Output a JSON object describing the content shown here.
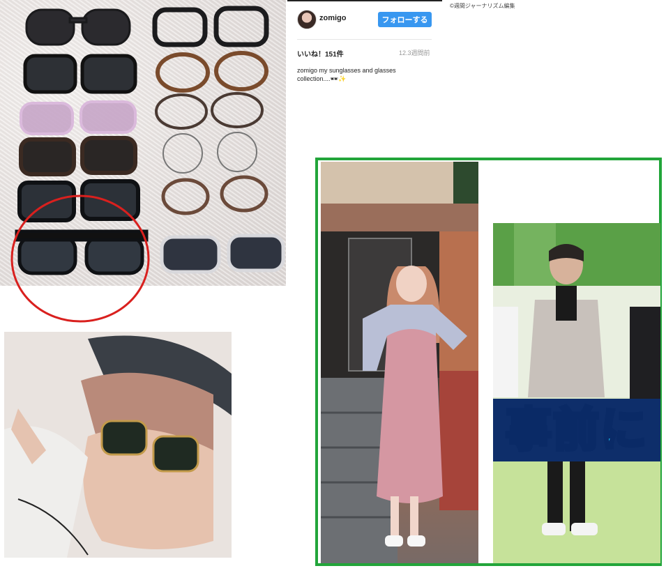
{
  "instagram": {
    "username": "zomigo",
    "follow_label": "フォローする",
    "likes": "いいね！151件",
    "timestamp": "12.3週間前",
    "caption": "zomigo my sunglasses and glasses collection....🕶✨"
  },
  "credit": "©週間ジャーナリズム編集",
  "tv_caption": "事前に",
  "colors": {
    "follow_button": "#3897f0",
    "highlight_circle": "#d9201e",
    "frame_border": "#22a53a"
  }
}
